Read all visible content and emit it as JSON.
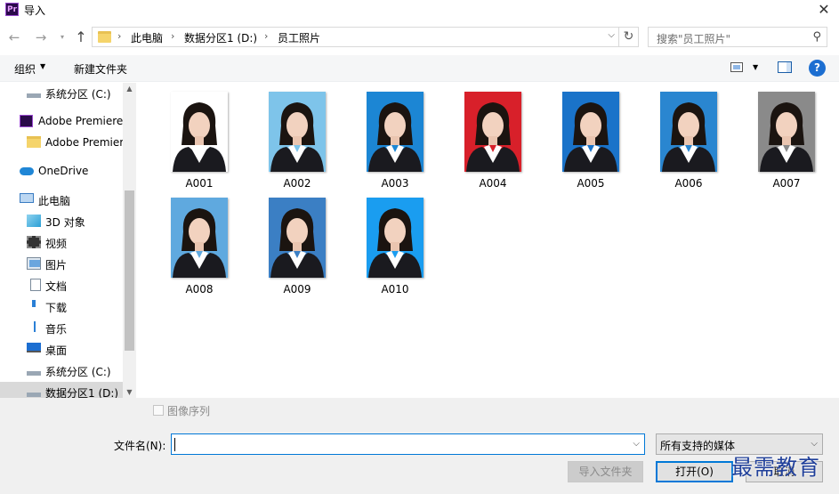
{
  "window": {
    "title": "导入",
    "app_icon_text": "Pr"
  },
  "address": {
    "crumbs": [
      "此电脑",
      "数据分区1 (D:)",
      "员工照片"
    ]
  },
  "search": {
    "placeholder": "搜索\"员工照片\""
  },
  "toolbar": {
    "organize": "组织",
    "new_folder": "新建文件夹"
  },
  "nav": {
    "items": [
      {
        "label": "系统分区 (C:)",
        "icon": "drive-icon"
      },
      {
        "label": "Adobe Premiere",
        "icon": "premiere-icon"
      },
      {
        "label": "Adobe Premier",
        "icon": "folder-icon"
      },
      {
        "label": "OneDrive",
        "icon": "cloud-icon"
      },
      {
        "label": "此电脑",
        "icon": "computer-icon"
      },
      {
        "label": "3D 对象",
        "icon": "cube-icon"
      },
      {
        "label": "视频",
        "icon": "video-icon"
      },
      {
        "label": "图片",
        "icon": "pictures-icon"
      },
      {
        "label": "文档",
        "icon": "document-icon"
      },
      {
        "label": "下载",
        "icon": "download-icon"
      },
      {
        "label": "音乐",
        "icon": "music-icon"
      },
      {
        "label": "桌面",
        "icon": "desktop-icon"
      },
      {
        "label": "系统分区 (C:)",
        "icon": "drive-icon"
      },
      {
        "label": "数据分区1 (D:)",
        "icon": "drive-icon"
      }
    ]
  },
  "files": [
    {
      "name": "A001",
      "bg": "#ffffff"
    },
    {
      "name": "A002",
      "bg": "#7ec4ea"
    },
    {
      "name": "A003",
      "bg": "#1c86d4"
    },
    {
      "name": "A004",
      "bg": "#d8202a"
    },
    {
      "name": "A005",
      "bg": "#1a73c9"
    },
    {
      "name": "A006",
      "bg": "#2a86d0"
    },
    {
      "name": "A007",
      "bg": "#8a8a8a"
    },
    {
      "name": "A008",
      "bg": "#5fa9df"
    },
    {
      "name": "A009",
      "bg": "#3b7fc4"
    },
    {
      "name": "A010",
      "bg": "#1a9df0"
    }
  ],
  "bottom": {
    "sequence_label": "图像序列",
    "filename_label": "文件名(N):",
    "filename_value": "",
    "filetype": "所有支持的媒体",
    "import_folder": "导入文件夹",
    "open": "打开(O)",
    "cancel": "取消"
  },
  "watermark": "最需教育",
  "colors": {
    "accent": "#0078d7",
    "selection": "#d9d9d9"
  }
}
